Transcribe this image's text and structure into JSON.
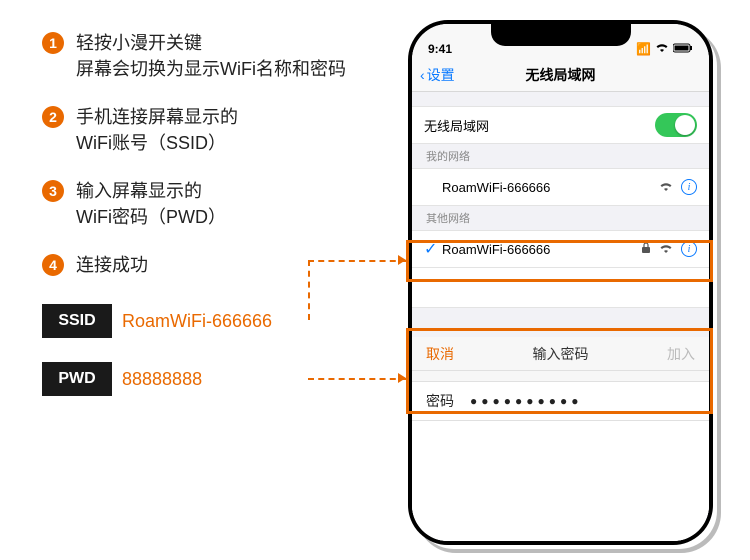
{
  "steps": [
    {
      "num": "1",
      "text": "轻按小漫开关键\n屏幕会切换为显示WiFi名称和密码"
    },
    {
      "num": "2",
      "text": "手机连接屏幕显示的\nWiFi账号（SSID）"
    },
    {
      "num": "3",
      "text": "输入屏幕显示的\nWiFi密码（PWD）"
    },
    {
      "num": "4",
      "text": "连接成功"
    }
  ],
  "credentials": {
    "ssid_label": "SSID",
    "ssid_value": "RoamWiFi-666666",
    "pwd_label": "PWD",
    "pwd_value": "88888888"
  },
  "phone": {
    "status": {
      "time": "9:41",
      "signal": "▪▪▪▪",
      "wifi": "▾",
      "battery": "▮"
    },
    "nav": {
      "back": "设置",
      "title": "无线局域网"
    },
    "wifi_toggle_label": "无线局域网",
    "sections": {
      "my": "我的网络",
      "other": "其他网络"
    },
    "my_network": "RoamWiFi-666666",
    "selected_network": "RoamWiFi-666666",
    "password_panel": {
      "cancel": "取消",
      "title": "输入密码",
      "join": "加入",
      "label": "密码",
      "dots": "●●●●●●●●●●"
    }
  }
}
